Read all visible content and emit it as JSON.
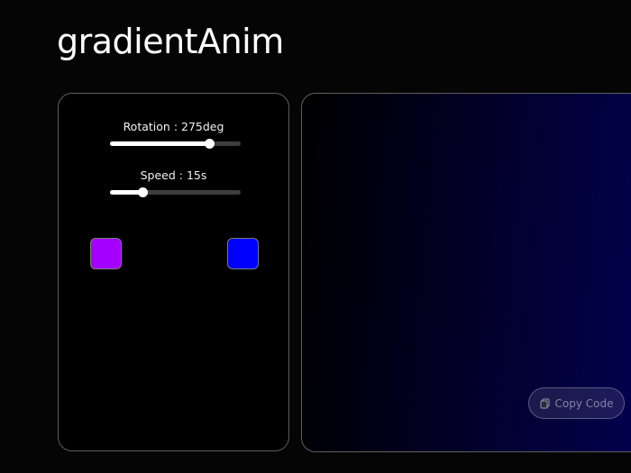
{
  "app": {
    "title": "gradientAnim"
  },
  "controls": {
    "rotation": {
      "label": "Rotation : 275deg",
      "value": 275,
      "min": 0,
      "max": 360
    },
    "speed": {
      "label": "Speed : 15s",
      "value": 15,
      "min": 0,
      "max": 60
    },
    "colors": {
      "start": "#a500ff",
      "end": "#0000ff"
    }
  },
  "preview": {
    "copy_label": "Copy Code",
    "copy_icon": "copy-icon",
    "gradient_from": "#000000",
    "gradient_to": "#03014f"
  }
}
